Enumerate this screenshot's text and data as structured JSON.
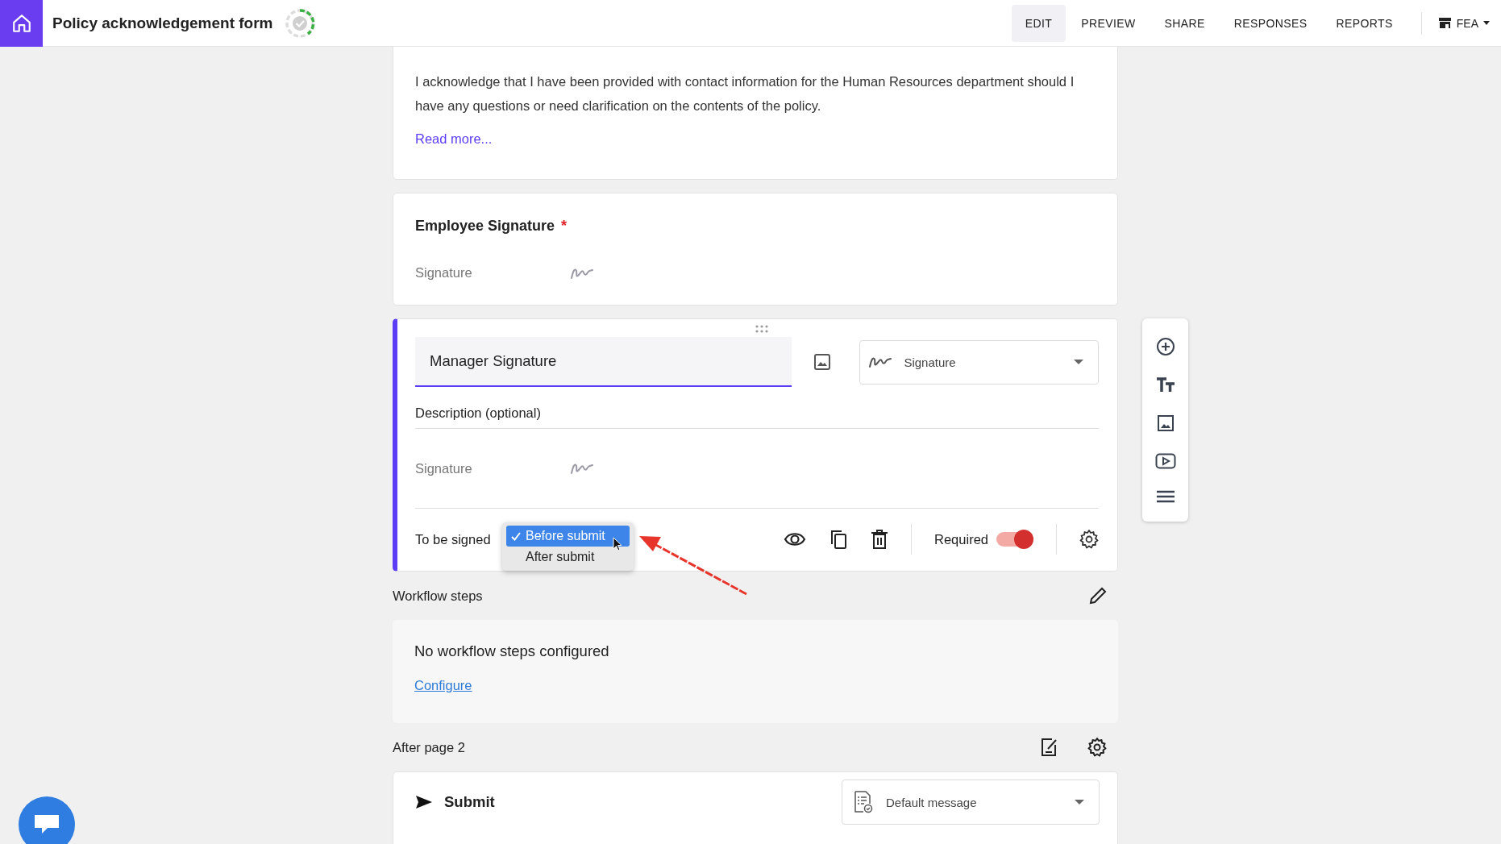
{
  "header": {
    "title": "Policy acknowledgement form",
    "tabs": [
      {
        "label": "EDIT",
        "selected": true
      },
      {
        "label": "PREVIEW",
        "selected": false
      },
      {
        "label": "SHARE",
        "selected": false
      },
      {
        "label": "RESPONSES",
        "selected": false
      },
      {
        "label": "REPORTS",
        "selected": false
      }
    ],
    "account": "FEA"
  },
  "intro_card": {
    "paragraph": "I acknowledge that I have been provided with contact information for the Human Resources department should I have any questions or need clarification on the contents of the policy.",
    "link": "Read more..."
  },
  "employee_card": {
    "title": "Employee Signature",
    "required_mark": "*",
    "answer_label": "Signature"
  },
  "manager_card": {
    "title_value": "Manager Signature",
    "type": "Signature",
    "description_placeholder": "Description (optional)",
    "answer_label": "Signature",
    "to_be_signed_label": "To be signed",
    "options": [
      {
        "label": "Before submit",
        "selected": true
      },
      {
        "label": "After submit",
        "selected": false
      }
    ],
    "required_label": "Required",
    "required_on": true
  },
  "workflow": {
    "label": "Workflow steps",
    "message": "No workflow steps configured",
    "link": "Configure"
  },
  "after_page": {
    "label": "After page 2",
    "submit": "Submit",
    "message_type": "Default message"
  }
}
